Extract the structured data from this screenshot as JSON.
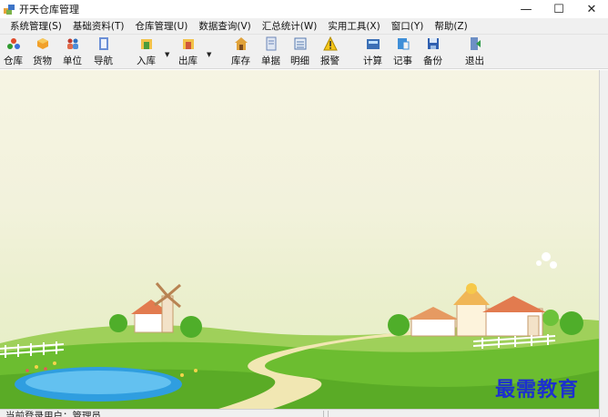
{
  "window": {
    "title": "开天仓库管理",
    "minimize_glyph": "—",
    "maximize_glyph": "☐",
    "close_glyph": "✕"
  },
  "menu": [
    {
      "label": "系统管理(S)"
    },
    {
      "label": "基础资料(T)"
    },
    {
      "label": "仓库管理(U)"
    },
    {
      "label": "数据查询(V)"
    },
    {
      "label": "汇总统计(W)"
    },
    {
      "label": "实用工具(X)"
    },
    {
      "label": "窗口(Y)"
    },
    {
      "label": "帮助(Z)"
    }
  ],
  "toolbar": [
    {
      "label": "仓库",
      "icon": "warehouse-icon"
    },
    {
      "label": "货物",
      "icon": "goods-icon"
    },
    {
      "label": "单位",
      "icon": "people-icon"
    },
    {
      "label": "导航",
      "icon": "navigation-icon"
    },
    {
      "label": "入库",
      "icon": "stock-in-icon"
    },
    {
      "label": "出库",
      "icon": "stock-out-icon"
    },
    {
      "label": "库存",
      "icon": "inventory-icon"
    },
    {
      "label": "单据",
      "icon": "document-icon"
    },
    {
      "label": "明细",
      "icon": "detail-icon"
    },
    {
      "label": "报警",
      "icon": "alarm-icon"
    },
    {
      "label": "计算",
      "icon": "calculator-icon"
    },
    {
      "label": "记事",
      "icon": "notepad-icon"
    },
    {
      "label": "备份",
      "icon": "backup-icon"
    },
    {
      "label": "退出",
      "icon": "exit-icon"
    }
  ],
  "status": {
    "user_text": "当前登录用户：管理员"
  },
  "watermark": "最需教育",
  "colors": {
    "sky": "#f4f3e0",
    "grass": "#5fb52c",
    "pond": "#3aa8e6",
    "watermark": "#1c2fd0"
  }
}
